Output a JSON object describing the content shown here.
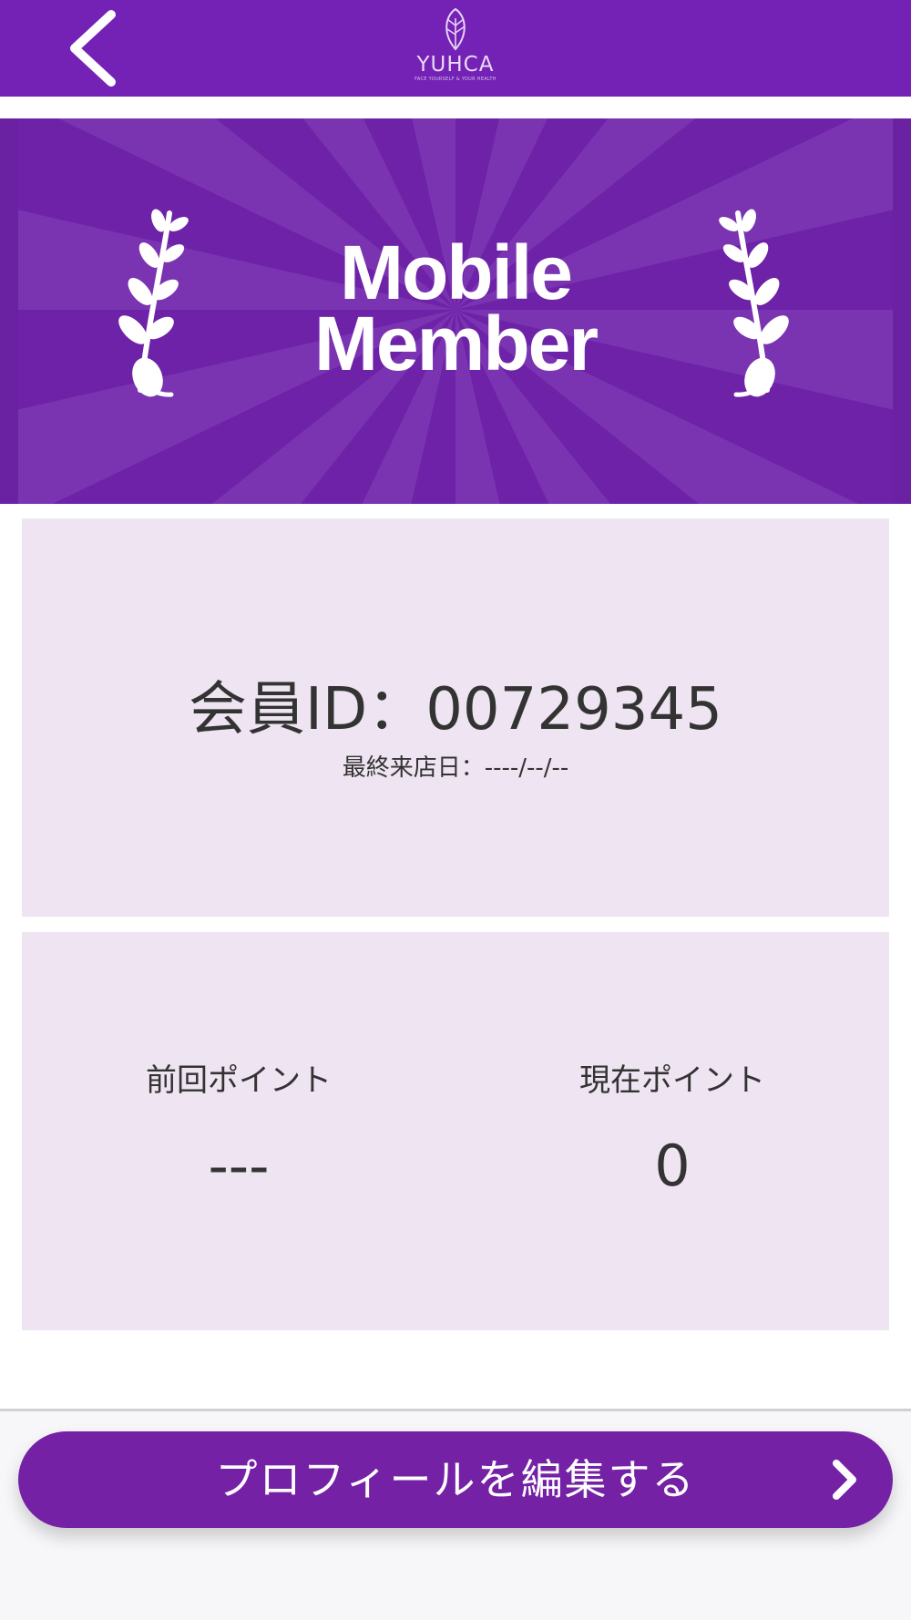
{
  "header": {
    "back_icon": "chevron-left-icon",
    "logo": {
      "wordmark": "YUHCA",
      "tagline": "FACE YOURSELF & YOUR HEALTH"
    },
    "background_color": "#7421b5"
  },
  "banner": {
    "title_line1": "Mobile",
    "title_line2": "Member",
    "decoration_icon": "laurel-branch-icon"
  },
  "member_card": {
    "member_id_text": "会員ID：00729345",
    "last_visit_text": "最終来店日：----/--/--"
  },
  "points_card": {
    "previous": {
      "label": "前回ポイント",
      "value": "---"
    },
    "current": {
      "label": "現在ポイント",
      "value": "0"
    }
  },
  "footer": {
    "edit_profile_label": "プロフィールを編集する",
    "edit_profile_icon": "chevron-right-icon",
    "accent_color": "#7421a5"
  }
}
